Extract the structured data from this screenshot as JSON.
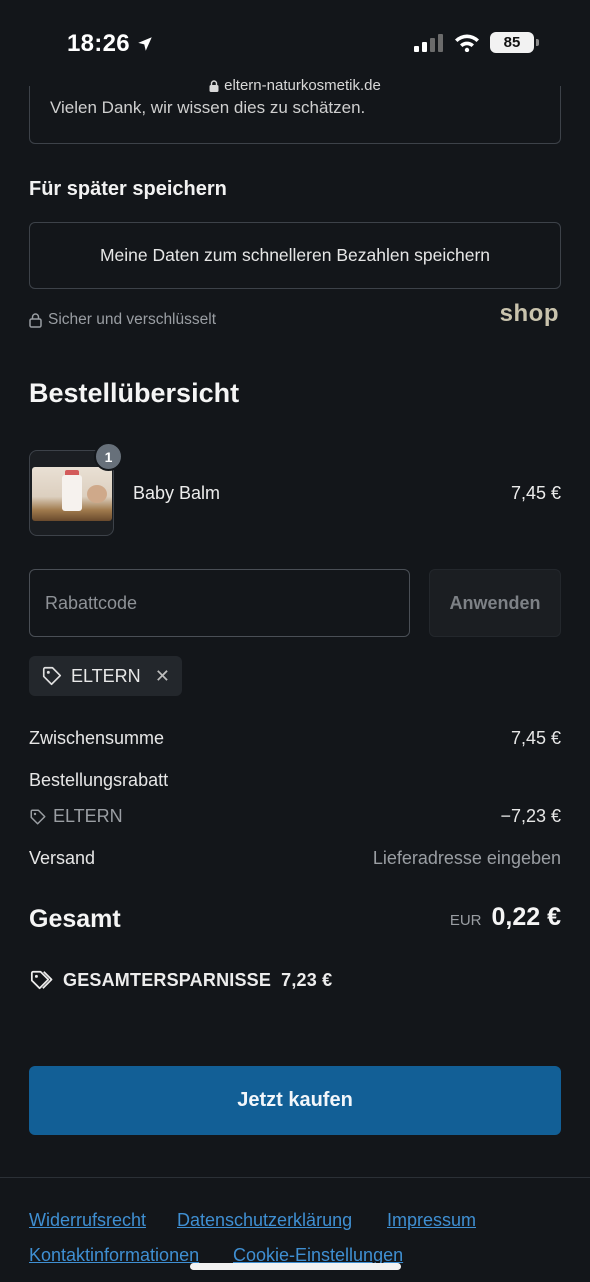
{
  "status_bar": {
    "time": "18:26",
    "battery": "85"
  },
  "browser": {
    "url": "eltern-naturkosmetik.de"
  },
  "note_field": {
    "text": "Vielen Dank, wir wissen dies zu schätzen."
  },
  "save_section": {
    "heading": "Für später speichern",
    "button_label": "Meine Daten zum schnelleren Bezahlen speichern",
    "secure_label": "Sicher und verschlüsselt",
    "provider_logo": "shop"
  },
  "order_summary": {
    "heading": "Bestellübersicht",
    "items": [
      {
        "name": "Baby Balm",
        "price": "7,45 €",
        "quantity": "1"
      }
    ]
  },
  "discount": {
    "placeholder": "Rabattcode",
    "apply_label": "Anwenden",
    "applied_code": "ELTERN"
  },
  "totals": {
    "subtotal_label": "Zwischensumme",
    "subtotal_value": "7,45 €",
    "discount_label": "Bestellungsrabatt",
    "discount_code": "ELTERN",
    "discount_value": "−7,23 €",
    "shipping_label": "Versand",
    "shipping_value": "Lieferadresse eingeben",
    "total_label": "Gesamt",
    "total_currency": "EUR",
    "total_value": "0,22 €",
    "savings_label": "GESAMTERSPARNISSE",
    "savings_value": "7,23 €"
  },
  "buy_button": {
    "label": "Jetzt kaufen"
  },
  "footer": {
    "links": [
      "Widerrufsrecht",
      "Datenschutzerklärung",
      "Impressum",
      "Kontaktinformationen",
      "Cookie-Einstellungen"
    ]
  },
  "colors": {
    "background": "#13161a",
    "primary_button": "#125f96",
    "link": "#3f8fd2",
    "border": "#3d4249"
  }
}
